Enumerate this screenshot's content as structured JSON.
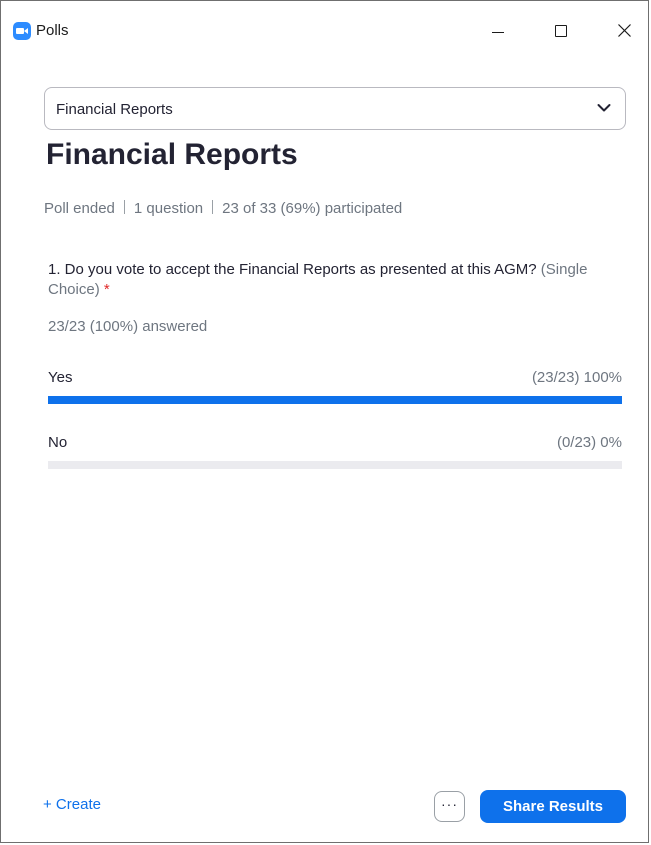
{
  "window": {
    "title": "Polls",
    "app_icon": "zoom-camera-icon",
    "controls": [
      "minimize-icon",
      "maximize-icon",
      "close-icon"
    ]
  },
  "dropdown": {
    "selected": "Financial Reports",
    "icon": "chevron-down-icon"
  },
  "poll": {
    "title": "Financial Reports",
    "status": "Poll ended",
    "questions_count": "1 question",
    "participation": "23 of 33 (69%) participated"
  },
  "question": {
    "text": "1. Do you vote to accept the Financial Reports as presented at this AGM?",
    "type": "(Single Choice)",
    "required_marker": "*",
    "answered": "23/23 (100%) answered",
    "options": [
      {
        "label": "Yes",
        "result": "(23/23) 100%",
        "fraction": 1.0
      },
      {
        "label": "No",
        "result": "(0/23) 0%",
        "fraction": 0.0
      }
    ]
  },
  "footer": {
    "create_label": "+ Create",
    "more_label": "···",
    "share_label": "Share Results"
  },
  "colors": {
    "accent": "#0e71eb",
    "track": "#ebebef",
    "required": "#e02828"
  }
}
